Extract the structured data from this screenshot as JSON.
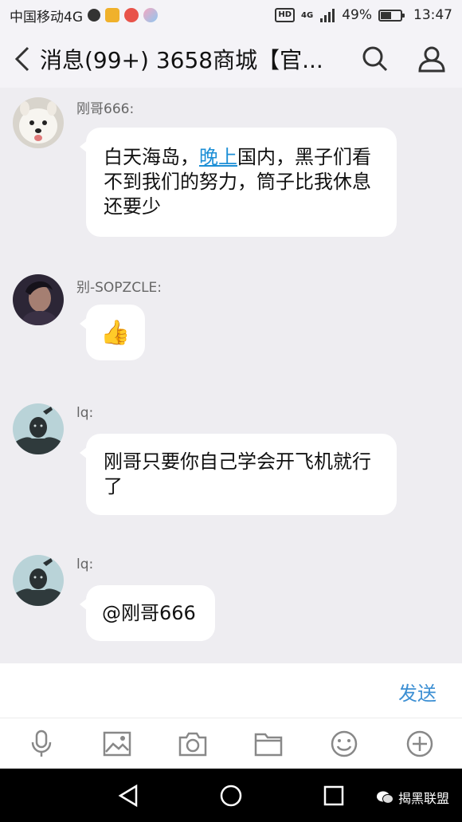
{
  "status_bar": {
    "carrier": "中国移动4G",
    "battery": "49%",
    "battery_level": 0.49,
    "time": "13:47",
    "hd": "HD",
    "net": "4G"
  },
  "header": {
    "title": "消息(99+) 3658商城【官..."
  },
  "messages": [
    {
      "sender": "刚哥666:",
      "text_before": "白天海岛，",
      "link": "晚上",
      "text_after": "国内，黑子们看不到我们的努力，筒子比我休息还要少"
    },
    {
      "sender": "别-SOPZCLE:",
      "emoji": "👍"
    },
    {
      "sender": "lq:",
      "text": "刚哥只要你自己学会开飞机就行了"
    },
    {
      "sender": "lq:",
      "text": "@刚哥666"
    }
  ],
  "input": {
    "send_label": "发送"
  },
  "watermark": {
    "label": "揭黑联盟"
  },
  "colors": {
    "accent": "#3c8fd3",
    "link": "#1d8fd6",
    "background": "#eeedf1"
  }
}
